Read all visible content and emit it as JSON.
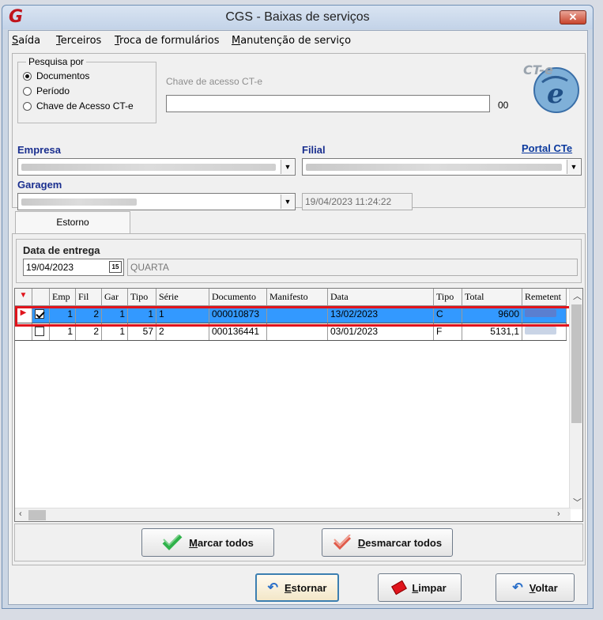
{
  "window": {
    "title": "CGS - Baixas de serviços",
    "close_label": "✕"
  },
  "menu": [
    "Saída",
    "Terceiros",
    "Troca de formulários",
    "Manutenção de serviço"
  ],
  "search": {
    "group_title": "Pesquisa por",
    "options": [
      "Documentos",
      "Período",
      "Chave de Acesso CT-e"
    ],
    "selected": "Documentos",
    "key_label": "Chave de acesso CT-e",
    "key_value": "",
    "key_suffix": "00"
  },
  "logo": {
    "text": "CT-e"
  },
  "portal_link": "Portal CTe",
  "fields": {
    "empresa_label": "Empresa",
    "filial_label": "Filial",
    "garagem_label": "Garagem",
    "timestamp": "19/04/2023 11:24:22"
  },
  "tabs": [
    "Estorno"
  ],
  "delivery": {
    "label": "Data de entrega",
    "date": "19/04/2023",
    "weekday": "QUARTA"
  },
  "grid": {
    "columns": [
      "Emp",
      "Fil",
      "Gar",
      "Tipo",
      "Série",
      "Documento",
      "Manifesto",
      "Data",
      "Tipo",
      "Total",
      "Remetent"
    ],
    "rows": [
      {
        "checked": true,
        "emp": "1",
        "fil": "2",
        "gar": "1",
        "tipo": "1",
        "serie": "1",
        "documento": "000010873",
        "manifesto": "",
        "data": "13/02/2023",
        "tipo2": "C",
        "total": "9600"
      },
      {
        "checked": false,
        "emp": "1",
        "fil": "2",
        "gar": "1",
        "tipo": "57",
        "serie": "2",
        "documento": "000136441",
        "manifesto": "",
        "data": "03/01/2023",
        "tipo2": "F",
        "total": "5131,1"
      }
    ]
  },
  "buttons": {
    "mark_all": "Marcar todos",
    "unmark_all": "Desmarcar todos",
    "reverse": "Estornar",
    "clear": "Limpar",
    "back": "Voltar"
  },
  "colors": {
    "selection": "#3399ff",
    "highlight": "#e0141c",
    "label_blue": "#1a2f8f"
  }
}
